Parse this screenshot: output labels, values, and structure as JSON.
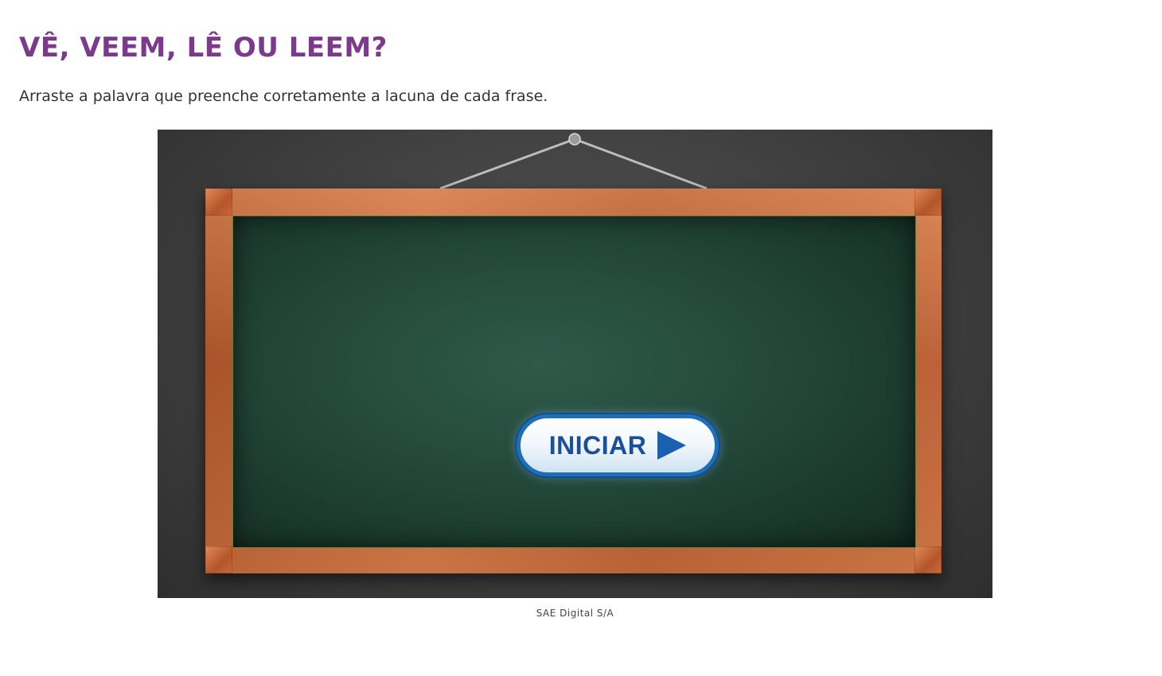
{
  "page": {
    "title": "VÊ, VEEM, LÊ OU LEEM?",
    "instructions": "Arraste a palavra que preenche corretamente a lacuna de cada frase."
  },
  "activity": {
    "start_button_label": "INICIAR",
    "start_button_icon": "play-icon",
    "caption": "SAE Digital S/A"
  },
  "colors": {
    "title": "#7b3a8c",
    "chalkboard": "#23483a",
    "frame_wood": "#c86c3b",
    "button_border": "#1f6fb8",
    "button_text": "#1a4f9c"
  }
}
